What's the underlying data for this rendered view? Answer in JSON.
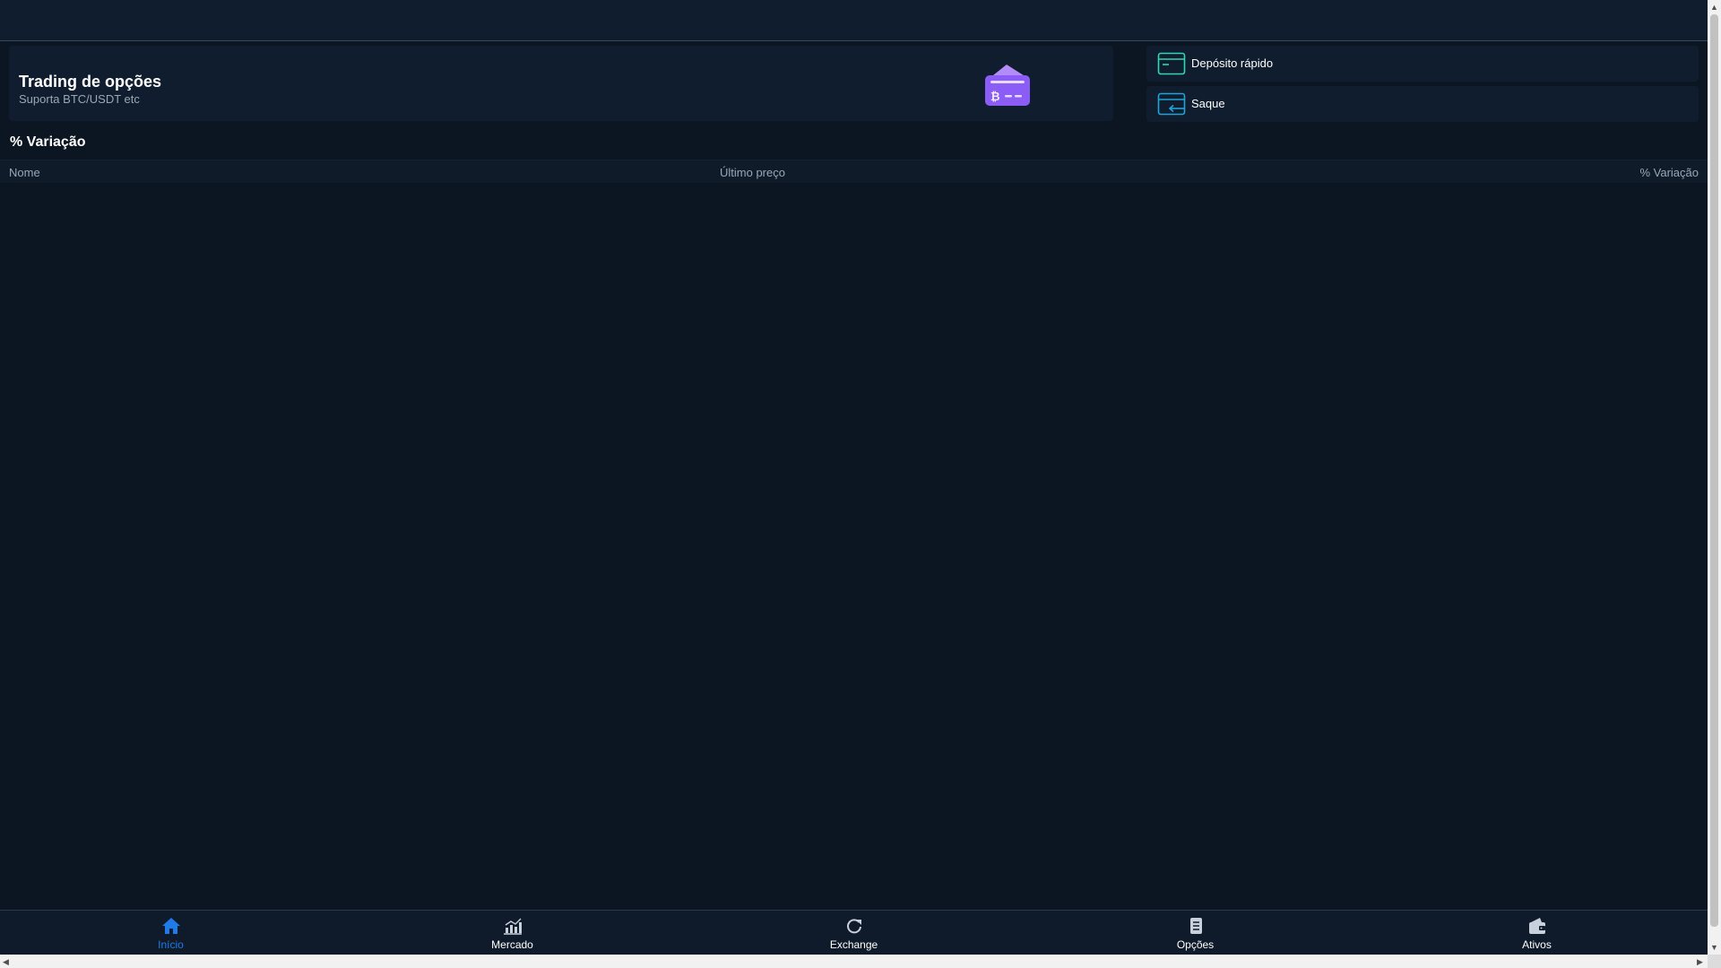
{
  "hero": {
    "title": "Trading de opções",
    "subtitle": "Suporta BTC/USDT etc",
    "icon": "crypto-wallet-icon"
  },
  "actions": [
    {
      "label": "Depósito rápido",
      "icon": "card-deposit-icon",
      "color": "#2fd6b8"
    },
    {
      "label": "Saque",
      "icon": "card-withdraw-icon",
      "color": "#1fa3d9"
    }
  ],
  "market": {
    "title": "% Variação",
    "columns": [
      "Nome",
      "Último preço",
      "% Variação"
    ],
    "rows": []
  },
  "nav": {
    "items": [
      {
        "label": "Início",
        "icon": "home-icon",
        "active": true
      },
      {
        "label": "Mercado",
        "icon": "chart-icon",
        "active": false
      },
      {
        "label": "Exchange",
        "icon": "refresh-icon",
        "active": false
      },
      {
        "label": "Opções",
        "icon": "document-icon",
        "active": false
      },
      {
        "label": "Ativos",
        "icon": "wallet-icon",
        "active": false
      }
    ]
  },
  "colors": {
    "accent": "#1e7be8",
    "background": "#0b1622",
    "panel": "#101d2e"
  }
}
